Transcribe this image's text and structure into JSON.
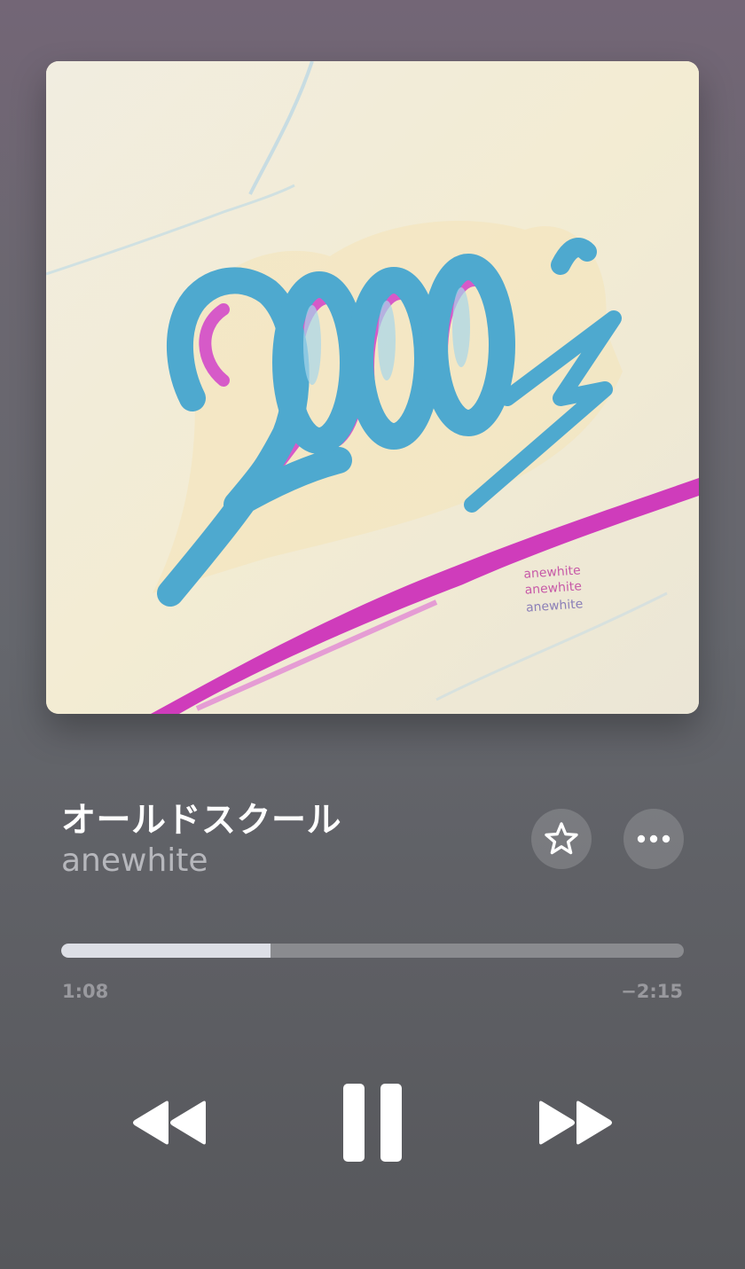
{
  "now_playing": {
    "title": "オールドスクール",
    "artist": "anewhite",
    "artwork_icon": "album-artwork-2000s-painting",
    "artwork_lettering": "2000's",
    "artwork_signature": "anewhite anewhite anewhite"
  },
  "actions": {
    "favorite_icon": "star-icon",
    "more_icon": "ellipsis-icon"
  },
  "playback": {
    "elapsed": "1:08",
    "remaining": "−2:15",
    "progress_fraction": 0.336
  },
  "controls": {
    "rewind_icon": "rewind-icon",
    "pause_icon": "pause-icon",
    "forward_icon": "fast-forward-icon"
  },
  "colors": {
    "artwork_blue": "#4ea9cf",
    "artwork_magenta": "#d63fc0",
    "artwork_canvas": "#efe8d6"
  }
}
